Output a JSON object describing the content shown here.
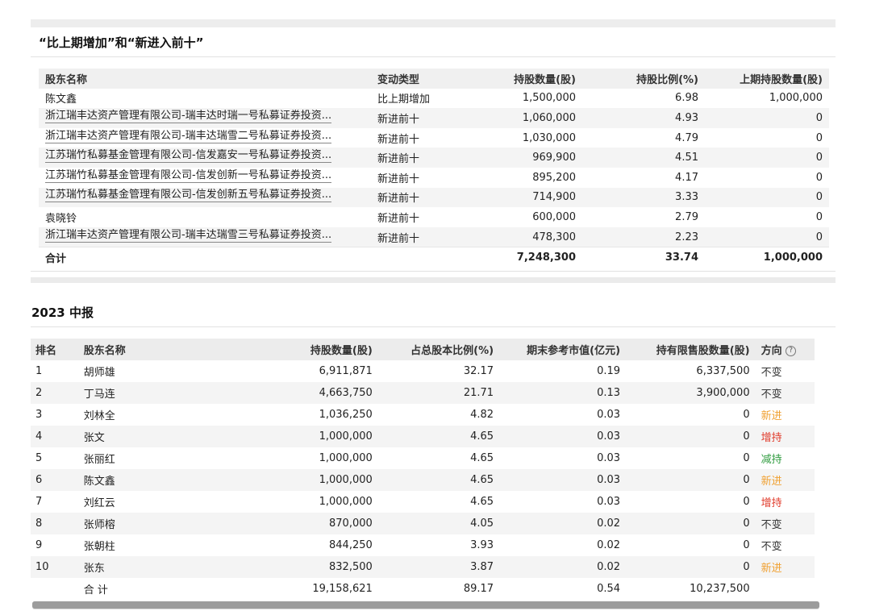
{
  "section1": {
    "title": "“比上期增加”和“新进入前十”",
    "headers": [
      "股东名称",
      "变动类型",
      "持股数量(股)",
      "持股比例(%)",
      "上期持股数量(股)"
    ],
    "rows": [
      {
        "name": "陈文鑫",
        "link": false,
        "type": "比上期增加",
        "shares": "1,500,000",
        "ratio": "6.98",
        "prev": "1,000,000"
      },
      {
        "name": "浙江瑞丰达资产管理有限公司-瑞丰达时瑞一号私募证券投资...",
        "link": true,
        "type": "新进前十",
        "shares": "1,060,000",
        "ratio": "4.93",
        "prev": "0"
      },
      {
        "name": "浙江瑞丰达资产管理有限公司-瑞丰达瑞雪二号私募证券投资...",
        "link": true,
        "type": "新进前十",
        "shares": "1,030,000",
        "ratio": "4.79",
        "prev": "0"
      },
      {
        "name": "江苏瑞竹私募基金管理有限公司-信发嘉安一号私募证券投资...",
        "link": true,
        "type": "新进前十",
        "shares": "969,900",
        "ratio": "4.51",
        "prev": "0"
      },
      {
        "name": "江苏瑞竹私募基金管理有限公司-信发创新一号私募证券投资...",
        "link": true,
        "type": "新进前十",
        "shares": "895,200",
        "ratio": "4.17",
        "prev": "0"
      },
      {
        "name": "江苏瑞竹私募基金管理有限公司-信发创新五号私募证券投资...",
        "link": true,
        "type": "新进前十",
        "shares": "714,900",
        "ratio": "3.33",
        "prev": "0"
      },
      {
        "name": "袁晓铃",
        "link": false,
        "type": "新进前十",
        "shares": "600,000",
        "ratio": "2.79",
        "prev": "0"
      },
      {
        "name": "浙江瑞丰达资产管理有限公司-瑞丰达瑞雪三号私募证券投资...",
        "link": true,
        "type": "新进前十",
        "shares": "478,300",
        "ratio": "2.23",
        "prev": "0"
      }
    ],
    "total": {
      "label": "合计",
      "type": "",
      "shares": "7,248,300",
      "ratio": "33.74",
      "prev": "1,000,000"
    }
  },
  "section2": {
    "title": "2023 中报",
    "headers": [
      "排名",
      "股东名称",
      "持股数量(股)",
      "占总股本比例(%)",
      "期末参考市值(亿元)",
      "持有限售股数量(股)",
      "方向"
    ],
    "help_glyph": "?",
    "rows": [
      {
        "rank": "1",
        "name": "胡师雄",
        "shares": "6,911,871",
        "ratio": "32.17",
        "value": "0.19",
        "restricted": "6,337,500",
        "dir": "不变",
        "dir_class": "neutral"
      },
      {
        "rank": "2",
        "name": "丁马连",
        "shares": "4,663,750",
        "ratio": "21.71",
        "value": "0.13",
        "restricted": "3,900,000",
        "dir": "不变",
        "dir_class": "neutral"
      },
      {
        "rank": "3",
        "name": "刘林全",
        "shares": "1,036,250",
        "ratio": "4.82",
        "value": "0.03",
        "restricted": "0",
        "dir": "新进",
        "dir_class": "new"
      },
      {
        "rank": "4",
        "name": "张文",
        "shares": "1,000,000",
        "ratio": "4.65",
        "value": "0.03",
        "restricted": "0",
        "dir": "增持",
        "dir_class": "inc"
      },
      {
        "rank": "5",
        "name": "张丽红",
        "shares": "1,000,000",
        "ratio": "4.65",
        "value": "0.03",
        "restricted": "0",
        "dir": "减持",
        "dir_class": "dec"
      },
      {
        "rank": "6",
        "name": "陈文鑫",
        "shares": "1,000,000",
        "ratio": "4.65",
        "value": "0.03",
        "restricted": "0",
        "dir": "新进",
        "dir_class": "new"
      },
      {
        "rank": "7",
        "name": "刘红云",
        "shares": "1,000,000",
        "ratio": "4.65",
        "value": "0.03",
        "restricted": "0",
        "dir": "增持",
        "dir_class": "inc"
      },
      {
        "rank": "8",
        "name": "张师榕",
        "shares": "870,000",
        "ratio": "4.05",
        "value": "0.02",
        "restricted": "0",
        "dir": "不变",
        "dir_class": "neutral"
      },
      {
        "rank": "9",
        "name": "张朝柱",
        "shares": "844,250",
        "ratio": "3.93",
        "value": "0.02",
        "restricted": "0",
        "dir": "不变",
        "dir_class": "neutral"
      },
      {
        "rank": "10",
        "name": "张东",
        "shares": "832,500",
        "ratio": "3.87",
        "value": "0.02",
        "restricted": "0",
        "dir": "新进",
        "dir_class": "new"
      }
    ],
    "total": {
      "rank": "",
      "label": "合 计",
      "shares": "19,158,621",
      "ratio": "89.17",
      "value": "0.54",
      "restricted": "10,237,500",
      "dir": ""
    }
  },
  "colors": {
    "new": "#f0a030",
    "increase": "#e03a2a",
    "decrease": "#2e9b3e",
    "neutral": "#333333"
  }
}
